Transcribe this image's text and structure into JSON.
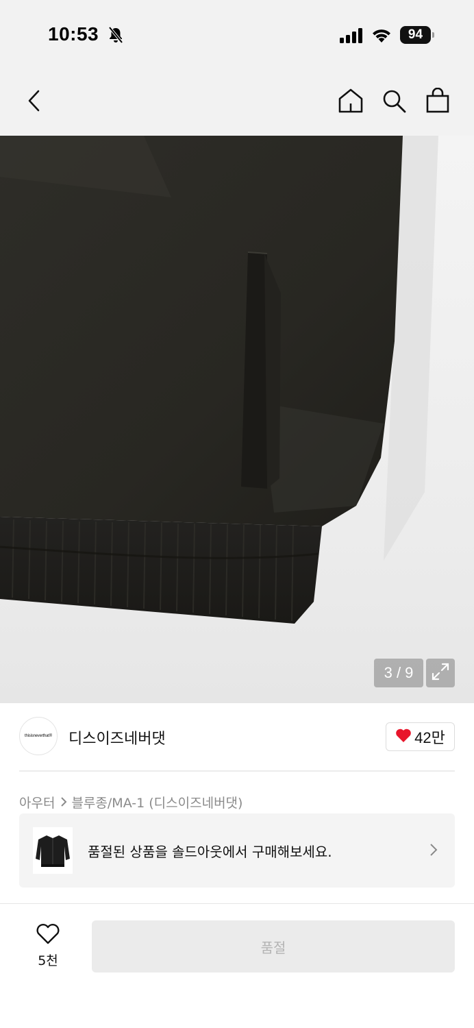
{
  "status_bar": {
    "time": "10:53",
    "battery": "94",
    "icons": [
      "bell-slash-icon",
      "signal-icon",
      "wifi-icon",
      "battery-icon"
    ]
  },
  "nav": {
    "icons": [
      "back-chevron-icon",
      "home-icon",
      "search-icon",
      "shopping-bag-icon"
    ]
  },
  "gallery": {
    "counter": "3 / 9",
    "current": 3,
    "total": 9,
    "expand_icon": "expand-icon"
  },
  "brand": {
    "logo_text": "thisisneverthat®",
    "name": "디스이즈네버댓",
    "like_count": "42만",
    "like_icon": "heart-filled-icon",
    "like_color": "#e8152b"
  },
  "breadcrumb": {
    "items": [
      "아우터",
      "블루종/MA-1 (디스이즈네버댓)"
    ]
  },
  "soldout_banner": {
    "text": "품절된 상품을 솔드아웃에서 구매해보세요.",
    "chevron_icon": "chevron-right-icon"
  },
  "bottom_bar": {
    "wish_count": "5천",
    "wish_icon": "heart-outline-icon",
    "buy_label": "품절"
  },
  "colors": {
    "accent_red": "#e8152b",
    "jacket": "#2a2924",
    "disabled_button": "#ebebeb"
  }
}
